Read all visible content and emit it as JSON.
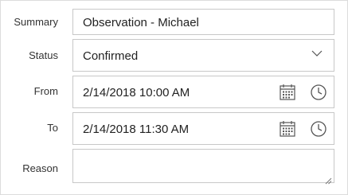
{
  "form": {
    "summary": {
      "label": "Summary",
      "value": "Observation - Michael"
    },
    "status": {
      "label": "Status",
      "value": "Confirmed",
      "icon": "chevron-down-icon"
    },
    "from": {
      "label": "From",
      "value": "2/14/2018 10:00 AM",
      "icons": [
        "calendar-icon",
        "clock-icon"
      ]
    },
    "to": {
      "label": "To",
      "value": "2/14/2018 11:30 AM",
      "icons": [
        "calendar-icon",
        "clock-icon"
      ]
    },
    "reason": {
      "label": "Reason",
      "value": ""
    }
  },
  "colors": {
    "border": "#c8c8c8",
    "text": "#333333",
    "icon": "#555555"
  }
}
